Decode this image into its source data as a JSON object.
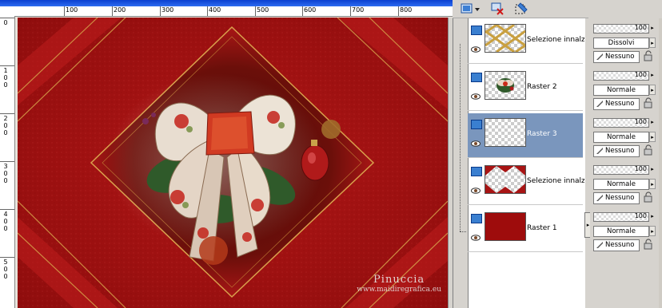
{
  "ruler": {
    "h_labels": [
      "100",
      "200",
      "300",
      "400",
      "500",
      "600",
      "700",
      "800"
    ],
    "v_labels": [
      "0",
      "100",
      "200",
      "300",
      "400",
      "500"
    ]
  },
  "watermark": {
    "line1": "Pinuccia",
    "line2": "www.maidiregrafica.eu"
  },
  "layers": [
    {
      "name": "Selezione innalza",
      "opacity": "100",
      "blend": "Dissolvi",
      "mask": "Nessuno",
      "thumb": "gold-lattice",
      "selected": false
    },
    {
      "name": "Raster 2",
      "opacity": "100",
      "blend": "Normale",
      "mask": "Nessuno",
      "thumb": "bow",
      "selected": false
    },
    {
      "name": "Raster 3",
      "opacity": "100",
      "blend": "Normale",
      "mask": "Nessuno",
      "thumb": "empty",
      "selected": true
    },
    {
      "name": "Selezione innalza",
      "opacity": "100",
      "blend": "Normale",
      "mask": "Nessuno",
      "thumb": "red-frame",
      "selected": false
    },
    {
      "name": "Raster 1",
      "opacity": "100",
      "blend": "Normale",
      "mask": "Nessuno",
      "thumb": "solid-red",
      "selected": false
    }
  ],
  "colors": {
    "selected_row": "#7a96bd",
    "canvas_red": "#9e0f0f",
    "title_blue": "#0a3fd0"
  },
  "icons": {
    "toolbar": [
      "new-layer-icon",
      "delete-layer-icon",
      "mask-selection-icon"
    ],
    "row": [
      "layer-type-icon",
      "eye-icon"
    ],
    "props": [
      "brush-icon",
      "lock-icon"
    ]
  }
}
